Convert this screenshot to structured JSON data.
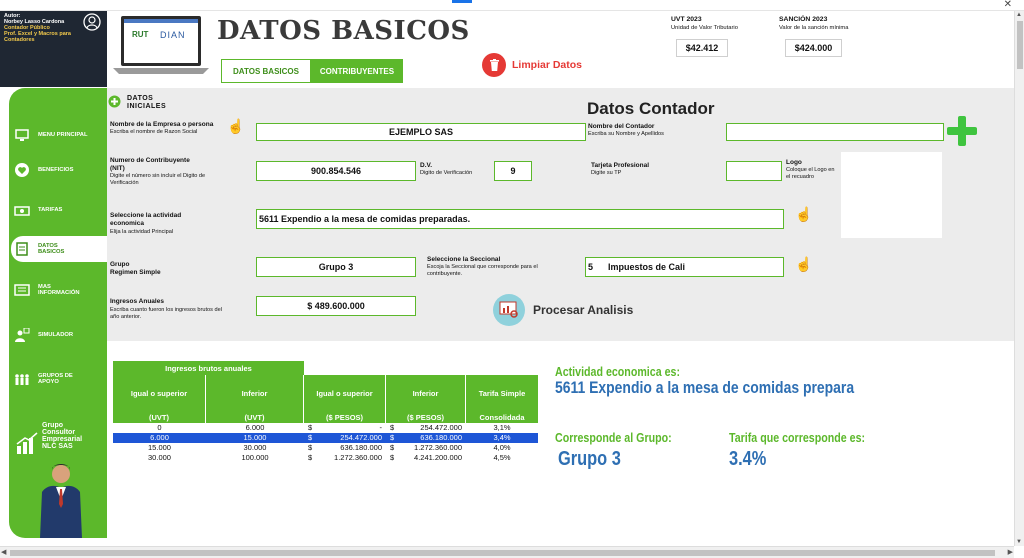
{
  "window": {
    "close_glyph": "✕"
  },
  "author": {
    "label": "Autor:",
    "name": "Norbey Lasso Cardona",
    "role1": "Contador Público",
    "role2": "Prof. Excel y Macros para Contadores"
  },
  "nav": [
    {
      "label": "Menu principal",
      "icon": "monitor-icon"
    },
    {
      "label": "Beneficios",
      "icon": "heart-icon"
    },
    {
      "label": "Tarifas",
      "icon": "money-icon"
    },
    {
      "label": "Datos basicos",
      "icon": "clipboard-icon",
      "active": true
    },
    {
      "label": "Mas información",
      "icon": "info-icon"
    },
    {
      "label": "Simulador",
      "icon": "people-icon"
    },
    {
      "label": "Grupos de apoyo",
      "icon": "group-icon"
    }
  ],
  "brand": {
    "line1": "Grupo",
    "line2": "Consultor",
    "line3": "Empresarial",
    "line4": "NLC SAS"
  },
  "header": {
    "title": "DATOS BASICOS",
    "laptop_rut": "RUT",
    "laptop_dian": "DIAN",
    "tab_datos": "DATOS BASICOS",
    "tab_contrib": "CONTRIBUYENTES",
    "limpiar": "Limpiar Datos",
    "uvt_title": "UVT 2023",
    "uvt_sub": "Unidad de Valor Tributario",
    "uvt_value": "$42.412",
    "sancion_title": "SANCIÓN 2023",
    "sancion_sub": "Valor de la sanción mínima",
    "sancion_value": "$424.000"
  },
  "form": {
    "section_title1": "DATOS",
    "section_title2": "INICIALES",
    "contador_title": "Datos Contador",
    "empresa_label": "Nombre de la Empresa o persona",
    "empresa_sub": "Escriba el nombre de Razon Social",
    "empresa_value": "EJEMPLO SAS",
    "contador_name_label": "Nombre del Contador",
    "contador_name_sub": "Escriba su Nombre y Apellidos",
    "contador_name_value": "",
    "nit_label1": "Numero de Contribuyente",
    "nit_label2": "(NIT)",
    "nit_sub": "Digite el número sin incluir el Digito de Verificación",
    "nit_value": "900.854.546",
    "dv_label": "D.V.",
    "dv_sub": "Digito de Verificación",
    "dv_value": "9",
    "tp_label": "Tarjeta Profesional",
    "tp_sub": "Digite su TP",
    "tp_value": "",
    "logo_label": "Logo",
    "logo_sub": "Coloque el Logo en el recuadro",
    "actividad_label1": "Seleccione la actividad",
    "actividad_label2": "economica",
    "actividad_sub": "Elija la actividad Principal",
    "actividad_value": "5611 Expendio a la mesa de comidas preparadas.",
    "grupo_label1": "Grupo",
    "grupo_label2": "Regimen Simple",
    "grupo_value": "Grupo 3",
    "seccional_label": "Seleccione la Seccional",
    "seccional_sub": "Escoja la Seccional que corresponde para el contribuyente.",
    "seccional_value": "5      Impuestos de Cali",
    "ingresos_label": "Ingresos Anuales",
    "ingresos_sub": "Escriba cuanto fueron los ingresos brutos del año anterior.",
    "ingresos_value": "$ 489.600.000",
    "procesar": "Procesar Analisis"
  },
  "table": {
    "title": "Ingresos brutos anuales",
    "headers": [
      {
        "a": "Igual o superior",
        "b": "(UVT)"
      },
      {
        "a": "Inferior",
        "b": "(UVT)"
      },
      {
        "a": "Igual o superior",
        "b": "($ PESOS)"
      },
      {
        "a": "Inferior",
        "b": "($ PESOS)"
      },
      {
        "a": "Tarifa Simple",
        "b": "Consolidada"
      }
    ],
    "rows": [
      {
        "c1": "0",
        "c2": "6.000",
        "c3": "-",
        "c4": "254.472.000",
        "c5": "3,1%"
      },
      {
        "c1": "6.000",
        "c2": "15.000",
        "c3": "254.472.000",
        "c4": "636.180.000",
        "c5": "3,4%",
        "selected": true
      },
      {
        "c1": "15.000",
        "c2": "30.000",
        "c3": "636.180.000",
        "c4": "1.272.360.000",
        "c5": "4,0%"
      },
      {
        "c1": "30.000",
        "c2": "100.000",
        "c3": "1.272.360.000",
        "c4": "4.241.200.000",
        "c5": "4,5%"
      }
    ],
    "dollar": "$"
  },
  "results": {
    "actividad_label": "Actividad economica es:",
    "actividad_value": "5611 Expendio a la mesa de comidas prepara",
    "grupo_label": "Corresponde al Grupo:",
    "grupo_value": "Grupo 3",
    "tarifa_label": "Tarifa que corresponde es:",
    "tarifa_value": "3.4%"
  },
  "colors": {
    "accent_green": "#5cb82b",
    "danger": "#e53935",
    "result_blue": "#2e6fb3",
    "selected_row": "#1e56d6"
  }
}
